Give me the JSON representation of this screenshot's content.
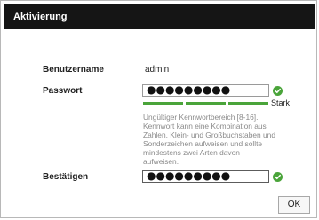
{
  "dialog": {
    "title": "Aktivierung"
  },
  "form": {
    "username_label": "Benutzername",
    "username_value": "admin",
    "password_label": "Passwort",
    "password_value": "●●●●●●●●●",
    "strength_label": "Stark",
    "strength_level": 1.0,
    "hint": "Ungültiger Kennwortbereich [8-16]. Kennwort kann eine Kombination aus Zahlen, Klein- und Großbuchstaben und Sonderzeichen aufweisen und sollte mindestens zwei Arten davon aufweisen.",
    "confirm_label": "Bestätigen",
    "confirm_value": "●●●●●●●●●"
  },
  "buttons": {
    "ok_label": "OK"
  },
  "colors": {
    "titlebar": "#151515",
    "valid": "#4aa43a"
  }
}
